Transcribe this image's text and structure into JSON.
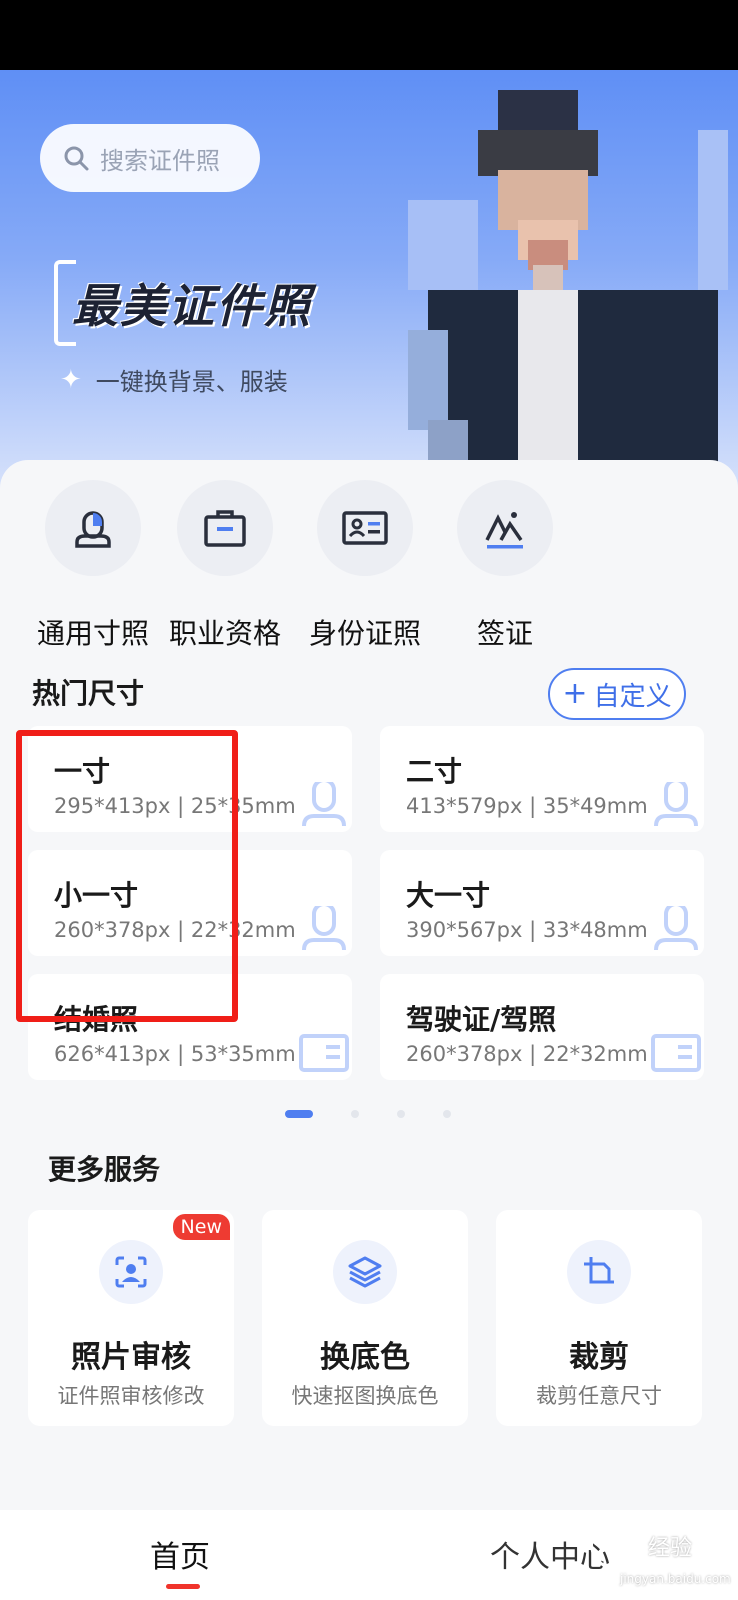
{
  "search": {
    "placeholder": "搜索证件照"
  },
  "hero": {
    "title": "最美证件照",
    "subtitle": "一键换背景、服装"
  },
  "categories": [
    {
      "label": "通用寸照",
      "icon": "person-bust-icon"
    },
    {
      "label": "职业资格",
      "icon": "briefcase-icon"
    },
    {
      "label": "身份证照",
      "icon": "id-card-icon"
    },
    {
      "label": "签证",
      "icon": "mountain-visa-icon"
    }
  ],
  "hot_sizes": {
    "title": "热门尺寸",
    "custom_label": "自定义",
    "items": [
      {
        "name": "一寸",
        "spec": "295*413px | 25*35mm"
      },
      {
        "name": "二寸",
        "spec": "413*579px | 35*49mm"
      },
      {
        "name": "小一寸",
        "spec": "260*378px | 22*32mm"
      },
      {
        "name": "大一寸",
        "spec": "390*567px | 33*48mm"
      },
      {
        "name": "结婚照",
        "spec": "626*413px | 53*35mm"
      },
      {
        "name": "驾驶证/驾照",
        "spec": "260*378px | 22*32mm"
      }
    ],
    "page_index": 1,
    "page_count": 4
  },
  "more_services": {
    "title": "更多服务",
    "items": [
      {
        "name": "照片审核",
        "desc": "证件照审核修改",
        "badge": "New",
        "icon": "face-scan-icon"
      },
      {
        "name": "换底色",
        "desc": "快速抠图换底色",
        "icon": "layers-icon"
      },
      {
        "name": "裁剪",
        "desc": "裁剪任意尺寸",
        "icon": "crop-icon"
      }
    ]
  },
  "nav": {
    "home": "首页",
    "me": "个人中心"
  },
  "watermark": {
    "brand": "经验",
    "site": "jingyan.baidu.com"
  },
  "colors": {
    "accent": "#4f7ef0",
    "highlight": "#f01e18",
    "badge": "#ee3b32"
  }
}
